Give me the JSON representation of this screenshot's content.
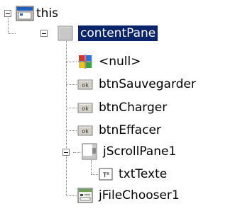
{
  "tree": {
    "root": {
      "label": "this",
      "expanded": true,
      "icon": "frame-icon"
    },
    "content_pane": {
      "label": "contentPane",
      "expanded": true,
      "selected": true,
      "icon": "panel-icon"
    },
    "null_layout": {
      "label": "<null>",
      "icon": "layout-grid-icon"
    },
    "btn_sauvegarder": {
      "label": "btnSauvegarder",
      "icon": "button-icon"
    },
    "btn_charger": {
      "label": "btnCharger",
      "icon": "button-icon"
    },
    "btn_effacer": {
      "label": "btnEffacer",
      "icon": "button-icon"
    },
    "scroll_pane": {
      "label": "jScrollPane1",
      "expanded": true,
      "icon": "scroll-pane-icon"
    },
    "txt_texte": {
      "label": "txtTexte",
      "icon": "text-area-icon"
    },
    "file_chooser": {
      "label": "jFileChooser1",
      "icon": "file-chooser-icon"
    }
  },
  "colors": {
    "selection": "#0a246a",
    "connector": "#808080"
  }
}
